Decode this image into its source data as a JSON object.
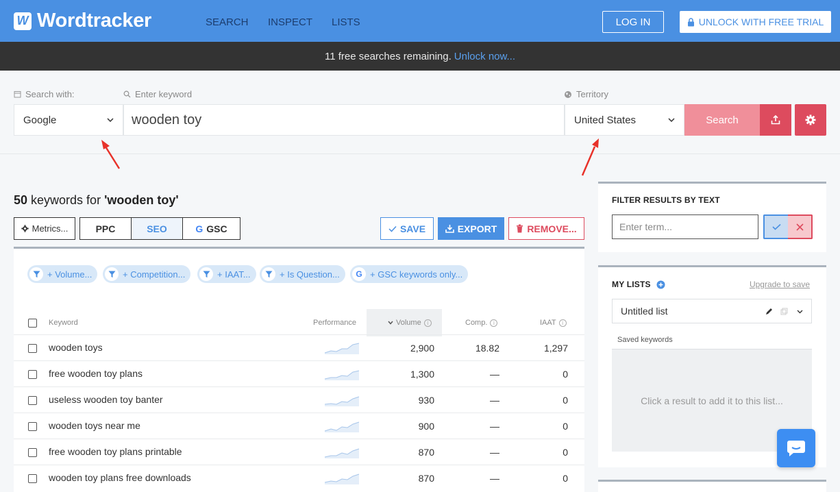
{
  "header": {
    "logo_mark": "W",
    "logo_text": "Wordtracker",
    "nav": [
      "SEARCH",
      "INSPECT",
      "LISTS"
    ],
    "login_label": "LOG IN",
    "unlock_label": "UNLOCK WITH FREE TRIAL"
  },
  "notice": {
    "text": "11 free searches remaining.",
    "link": "Unlock now..."
  },
  "search": {
    "engine_label": "Search with:",
    "engine_value": "Google",
    "keyword_label": "Enter keyword",
    "keyword_value": "wooden toy",
    "territory_label": "Territory",
    "territory_value": "United States",
    "search_button": "Search"
  },
  "results": {
    "count": "50",
    "title_mid": " keywords for ",
    "query": "'wooden toy'",
    "toolbar": {
      "metrics": "Metrics...",
      "ppc": "PPC",
      "seo": "SEO",
      "gsc": "GSC",
      "save": "SAVE",
      "export": "EXPORT",
      "remove": "REMOVE..."
    },
    "filters": [
      "+ Volume...",
      "+ Competition...",
      "+ IAAT...",
      "+ Is Question...",
      "+ GSC keywords only..."
    ],
    "columns": {
      "keyword": "Keyword",
      "performance": "Performance",
      "volume": "Volume",
      "comp": "Comp.",
      "iaat": "IAAT"
    },
    "rows": [
      {
        "keyword": "wooden toys",
        "volume": "2,900",
        "comp": "18.82",
        "iaat": "1,297"
      },
      {
        "keyword": "free wooden toy plans",
        "volume": "1,300",
        "comp": "—",
        "iaat": "0"
      },
      {
        "keyword": "useless wooden toy banter",
        "volume": "930",
        "comp": "—",
        "iaat": "0"
      },
      {
        "keyword": "wooden toys near me",
        "volume": "900",
        "comp": "—",
        "iaat": "0"
      },
      {
        "keyword": "free wooden toy plans printable",
        "volume": "870",
        "comp": "—",
        "iaat": "0"
      },
      {
        "keyword": "wooden toy plans free downloads",
        "volume": "870",
        "comp": "—",
        "iaat": "0"
      }
    ]
  },
  "filter_panel": {
    "title": "FILTER RESULTS BY TEXT",
    "placeholder": "Enter term..."
  },
  "lists_panel": {
    "title": "MY LISTS",
    "upgrade": "Upgrade to save",
    "list_name": "Untitled list",
    "saved_label": "Saved keywords",
    "empty_text": "Click a result to add it to this list..."
  },
  "colors": {
    "brand_blue": "#4a90e2",
    "danger_red": "#dd4b5e",
    "search_pink": "#f08f9a",
    "notice_bg": "#333333"
  }
}
